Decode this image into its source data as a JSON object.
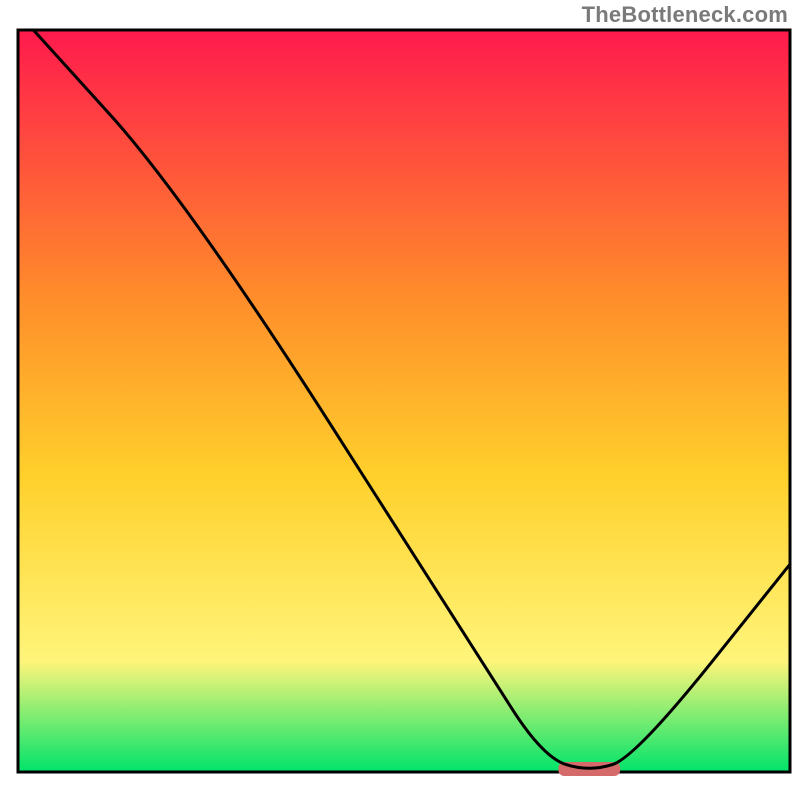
{
  "watermark": "TheBottleneck.com",
  "chart_data": {
    "type": "line",
    "title": "",
    "xlabel": "",
    "ylabel": "",
    "xlim": [
      0,
      100
    ],
    "ylim": [
      0,
      100
    ],
    "background_gradient": {
      "top": "#ff1a4d",
      "upper_mid": "#ff8a2b",
      "mid": "#ffd02b",
      "lower_mid": "#fff57a",
      "bottom": "#00e36a"
    },
    "marker": {
      "x_range": [
        70,
        78
      ],
      "y": 0,
      "color": "#d46a6a"
    },
    "series": [
      {
        "name": "curve",
        "points": [
          {
            "x": 2,
            "y": 100
          },
          {
            "x": 22,
            "y": 77
          },
          {
            "x": 60,
            "y": 15
          },
          {
            "x": 68,
            "y": 2
          },
          {
            "x": 74,
            "y": 0
          },
          {
            "x": 80,
            "y": 2
          },
          {
            "x": 100,
            "y": 28
          }
        ]
      }
    ]
  }
}
